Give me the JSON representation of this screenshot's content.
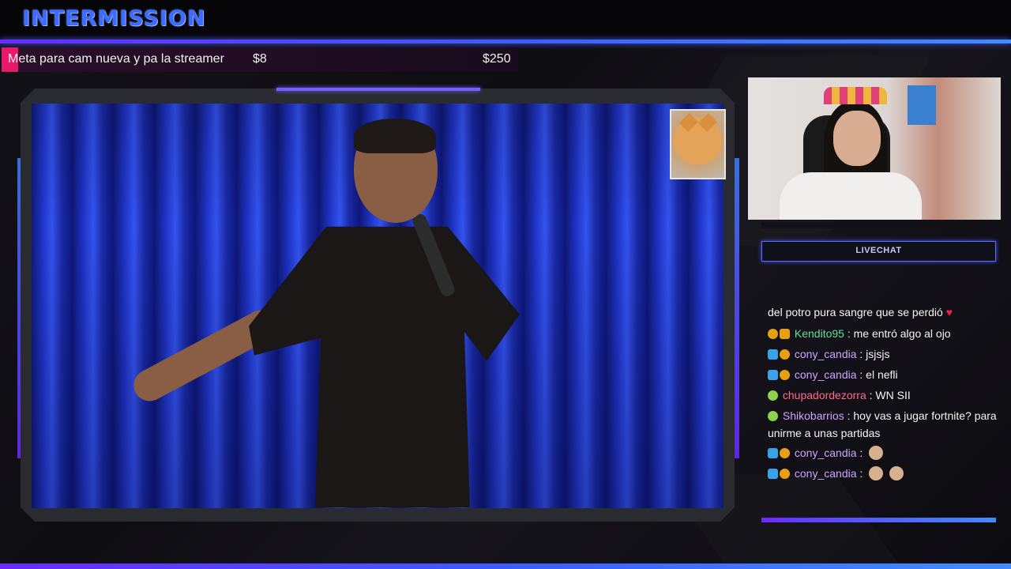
{
  "header": {
    "title": "INTERMISSION"
  },
  "goal": {
    "label": "Meta para cam nueva y pa la streamer",
    "current": "$8",
    "target": "$250",
    "progress": 0.032
  },
  "chat": {
    "title": "LIVECHAT",
    "cut_line": "del potro pura sangre que se perdió",
    "heart": "♥",
    "messages": [
      {
        "user": "Kendito95",
        "text": ": me entró algo al ojo"
      },
      {
        "user": "cony_candia",
        "text": ": jsjsjs"
      },
      {
        "user": "cony_candia",
        "text": ": el nefli"
      },
      {
        "user": "chupadordezorra",
        "text": ": WN SII"
      },
      {
        "user": "Shikobarrios",
        "text": ": hoy vas a jugar fortnite? para unirme a unas partidas"
      },
      {
        "user": "cony_candia",
        "text": ":"
      },
      {
        "user": "cony_candia",
        "text": ":"
      }
    ]
  },
  "colors": {
    "accent": "#3e6cff",
    "goal_fill": "#e8186a",
    "curtain": "#1f35c9"
  }
}
